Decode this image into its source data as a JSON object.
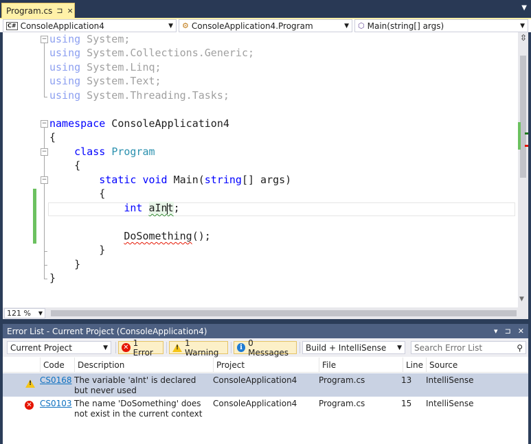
{
  "tab": {
    "label": "Program.cs",
    "pin": "⊐",
    "close": "×"
  },
  "navbar": {
    "project": "ConsoleApplication4",
    "type": "ConsoleApplication4.Program",
    "member": "Main(string[] args)"
  },
  "code": {
    "lines": [
      {
        "kw": "using",
        "rest": " System;"
      },
      {
        "kw": "using",
        "rest": " System.Collections.Generic;"
      },
      {
        "kw": "using",
        "rest": " System.Linq;"
      },
      {
        "kw": "using",
        "rest": " System.Text;"
      },
      {
        "kw": "using",
        "rest": " System.Threading.Tasks;"
      }
    ],
    "ns_kw": "namespace",
    "ns_name": " ConsoleApplication4",
    "open_brace": "{",
    "close_brace": "}",
    "class_kw": "class",
    "class_name": "Program",
    "static_kw": "static",
    "void_kw": "void",
    "main_name": " Main(",
    "string_kw": "string",
    "main_rest": "[] args)",
    "int_kw": "int",
    "var_a": "aIn",
    "var_b": "t",
    "semicolon": ";",
    "call_name": "DoSomething",
    "call_rest": "();"
  },
  "zoom": "121 %",
  "errorlist": {
    "title": "Error List - Current Project (ConsoleApplication4)",
    "scope": "Current Project",
    "errors_btn": "1 Error",
    "warnings_btn": "1 Warning",
    "messages_btn": "0 Messages",
    "build_filter": "Build + IntelliSense",
    "search_placeholder": "Search Error List",
    "columns": [
      "Code",
      "Description",
      "Project",
      "File",
      "Line",
      "Source"
    ],
    "rows": [
      {
        "severity": "warning",
        "code": "CS0168",
        "description": "The variable 'aInt' is declared but never used",
        "project": "ConsoleApplication4",
        "file": "Program.cs",
        "line": "13",
        "source": "IntelliSense"
      },
      {
        "severity": "error",
        "code": "CS0103",
        "description": "The name 'DoSomething' does not exist in the current context",
        "project": "ConsoleApplication4",
        "file": "Program.cs",
        "line": "15",
        "source": "IntelliSense"
      }
    ]
  }
}
